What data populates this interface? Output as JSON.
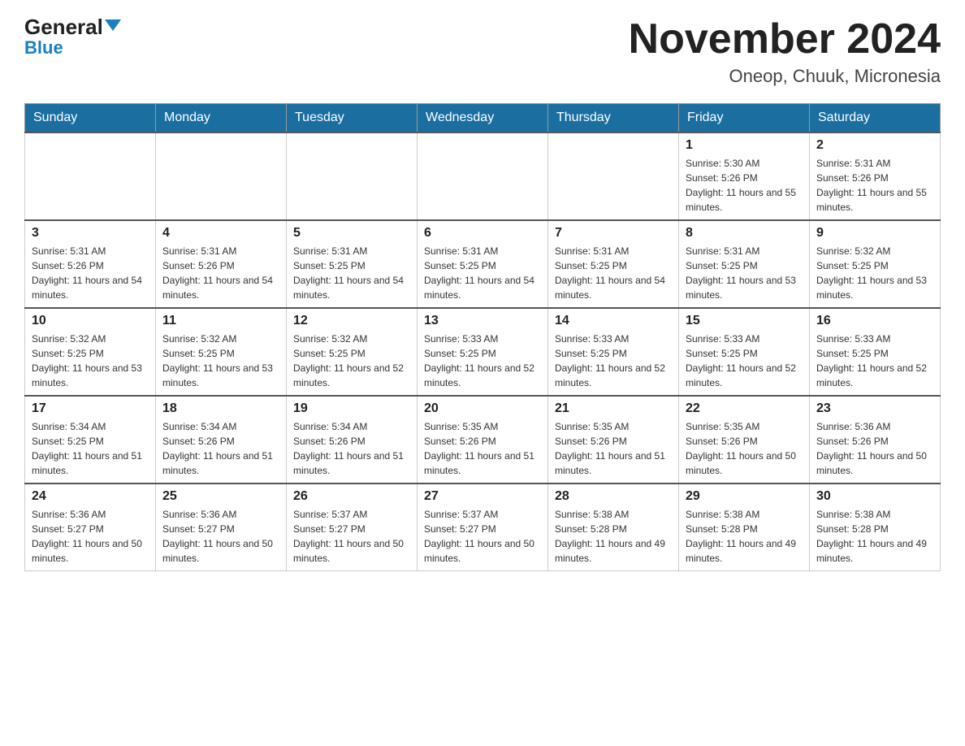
{
  "logo": {
    "general": "General",
    "triangle": "▲",
    "blue": "Blue"
  },
  "header": {
    "month_year": "November 2024",
    "location": "Oneop, Chuuk, Micronesia"
  },
  "weekdays": [
    "Sunday",
    "Monday",
    "Tuesday",
    "Wednesday",
    "Thursday",
    "Friday",
    "Saturday"
  ],
  "weeks": [
    [
      {
        "day": "",
        "info": ""
      },
      {
        "day": "",
        "info": ""
      },
      {
        "day": "",
        "info": ""
      },
      {
        "day": "",
        "info": ""
      },
      {
        "day": "",
        "info": ""
      },
      {
        "day": "1",
        "info": "Sunrise: 5:30 AM\nSunset: 5:26 PM\nDaylight: 11 hours and 55 minutes."
      },
      {
        "day": "2",
        "info": "Sunrise: 5:31 AM\nSunset: 5:26 PM\nDaylight: 11 hours and 55 minutes."
      }
    ],
    [
      {
        "day": "3",
        "info": "Sunrise: 5:31 AM\nSunset: 5:26 PM\nDaylight: 11 hours and 54 minutes."
      },
      {
        "day": "4",
        "info": "Sunrise: 5:31 AM\nSunset: 5:26 PM\nDaylight: 11 hours and 54 minutes."
      },
      {
        "day": "5",
        "info": "Sunrise: 5:31 AM\nSunset: 5:25 PM\nDaylight: 11 hours and 54 minutes."
      },
      {
        "day": "6",
        "info": "Sunrise: 5:31 AM\nSunset: 5:25 PM\nDaylight: 11 hours and 54 minutes."
      },
      {
        "day": "7",
        "info": "Sunrise: 5:31 AM\nSunset: 5:25 PM\nDaylight: 11 hours and 54 minutes."
      },
      {
        "day": "8",
        "info": "Sunrise: 5:31 AM\nSunset: 5:25 PM\nDaylight: 11 hours and 53 minutes."
      },
      {
        "day": "9",
        "info": "Sunrise: 5:32 AM\nSunset: 5:25 PM\nDaylight: 11 hours and 53 minutes."
      }
    ],
    [
      {
        "day": "10",
        "info": "Sunrise: 5:32 AM\nSunset: 5:25 PM\nDaylight: 11 hours and 53 minutes."
      },
      {
        "day": "11",
        "info": "Sunrise: 5:32 AM\nSunset: 5:25 PM\nDaylight: 11 hours and 53 minutes."
      },
      {
        "day": "12",
        "info": "Sunrise: 5:32 AM\nSunset: 5:25 PM\nDaylight: 11 hours and 52 minutes."
      },
      {
        "day": "13",
        "info": "Sunrise: 5:33 AM\nSunset: 5:25 PM\nDaylight: 11 hours and 52 minutes."
      },
      {
        "day": "14",
        "info": "Sunrise: 5:33 AM\nSunset: 5:25 PM\nDaylight: 11 hours and 52 minutes."
      },
      {
        "day": "15",
        "info": "Sunrise: 5:33 AM\nSunset: 5:25 PM\nDaylight: 11 hours and 52 minutes."
      },
      {
        "day": "16",
        "info": "Sunrise: 5:33 AM\nSunset: 5:25 PM\nDaylight: 11 hours and 52 minutes."
      }
    ],
    [
      {
        "day": "17",
        "info": "Sunrise: 5:34 AM\nSunset: 5:25 PM\nDaylight: 11 hours and 51 minutes."
      },
      {
        "day": "18",
        "info": "Sunrise: 5:34 AM\nSunset: 5:26 PM\nDaylight: 11 hours and 51 minutes."
      },
      {
        "day": "19",
        "info": "Sunrise: 5:34 AM\nSunset: 5:26 PM\nDaylight: 11 hours and 51 minutes."
      },
      {
        "day": "20",
        "info": "Sunrise: 5:35 AM\nSunset: 5:26 PM\nDaylight: 11 hours and 51 minutes."
      },
      {
        "day": "21",
        "info": "Sunrise: 5:35 AM\nSunset: 5:26 PM\nDaylight: 11 hours and 51 minutes."
      },
      {
        "day": "22",
        "info": "Sunrise: 5:35 AM\nSunset: 5:26 PM\nDaylight: 11 hours and 50 minutes."
      },
      {
        "day": "23",
        "info": "Sunrise: 5:36 AM\nSunset: 5:26 PM\nDaylight: 11 hours and 50 minutes."
      }
    ],
    [
      {
        "day": "24",
        "info": "Sunrise: 5:36 AM\nSunset: 5:27 PM\nDaylight: 11 hours and 50 minutes."
      },
      {
        "day": "25",
        "info": "Sunrise: 5:36 AM\nSunset: 5:27 PM\nDaylight: 11 hours and 50 minutes."
      },
      {
        "day": "26",
        "info": "Sunrise: 5:37 AM\nSunset: 5:27 PM\nDaylight: 11 hours and 50 minutes."
      },
      {
        "day": "27",
        "info": "Sunrise: 5:37 AM\nSunset: 5:27 PM\nDaylight: 11 hours and 50 minutes."
      },
      {
        "day": "28",
        "info": "Sunrise: 5:38 AM\nSunset: 5:28 PM\nDaylight: 11 hours and 49 minutes."
      },
      {
        "day": "29",
        "info": "Sunrise: 5:38 AM\nSunset: 5:28 PM\nDaylight: 11 hours and 49 minutes."
      },
      {
        "day": "30",
        "info": "Sunrise: 5:38 AM\nSunset: 5:28 PM\nDaylight: 11 hours and 49 minutes."
      }
    ]
  ]
}
